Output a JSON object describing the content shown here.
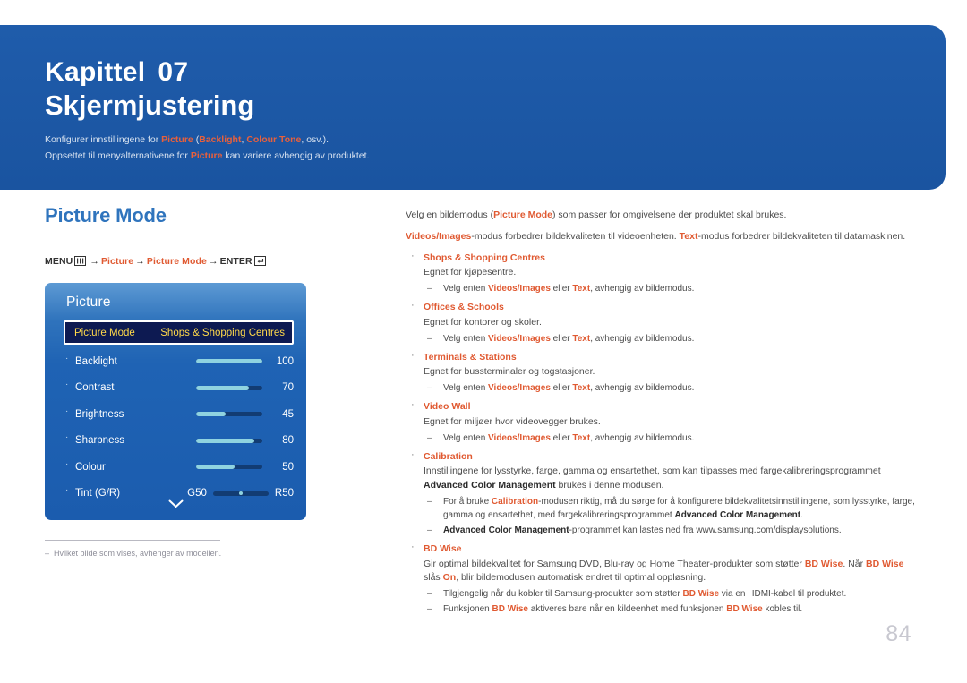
{
  "banner": {
    "chapter_label": "Kapittel",
    "chapter_number": "07",
    "title": "Skjermjustering",
    "sub1_pre": "Konfigurer innstillingene for ",
    "sub1_hl1": "Picture",
    "sub1_mid1": " (",
    "sub1_hl2": "Backlight",
    "sub1_mid2": ", ",
    "sub1_hl3": "Colour Tone",
    "sub1_post": ", osv.).",
    "sub2_pre": "Oppsettet til menyalternativene for ",
    "sub2_hl": "Picture",
    "sub2_post": " kan variere avhengig av produktet."
  },
  "left": {
    "section_title": "Picture Mode",
    "menu_path": {
      "menu_label": "MENU",
      "menu_icon": "menu-bars-icon",
      "arrow": "→",
      "step1": "Picture",
      "step2": "Picture Mode",
      "enter_label": "ENTER",
      "enter_icon": "enter-return-icon"
    },
    "osd": {
      "title": "Picture",
      "selected_row": {
        "label": "Picture Mode",
        "value": "Shops & Shopping Centres"
      },
      "rows": [
        {
          "label": "Backlight",
          "value": "100",
          "percent": 100
        },
        {
          "label": "Contrast",
          "value": "70",
          "percent": 80
        },
        {
          "label": "Brightness",
          "value": "45",
          "percent": 45
        },
        {
          "label": "Sharpness",
          "value": "80",
          "percent": 88
        },
        {
          "label": "Colour",
          "value": "50",
          "percent": 58
        }
      ],
      "tint_row": {
        "label": "Tint (G/R)",
        "left_value": "G50",
        "right_value": "R50"
      },
      "scroll_icon": "chevron-down-icon"
    },
    "footnote": {
      "dash": "–",
      "text": "Hvilket bilde som vises, avhenger av modellen."
    }
  },
  "right": {
    "intro1": {
      "pre": "Velg en bildemodus (",
      "hl": "Picture Mode",
      "post": ") som passer for omgivelsene der produktet skal brukes."
    },
    "intro2": {
      "hl1": "Videos/Images",
      "mid1": "-modus forbedrer bildekvaliteten til videoenheten. ",
      "hl2": "Text",
      "post": "-modus forbedrer bildekvaliteten til datamaskinen."
    },
    "sub_note": {
      "pre": "Velg enten ",
      "hl1": "Videos/Images",
      "mid": " eller ",
      "hl2": "Text",
      "post": ", avhengig av bildemodus."
    },
    "bullets": [
      {
        "title": "Shops & Shopping Centres",
        "body": "Egnet for kjøpesentre."
      },
      {
        "title": "Offices & Schools",
        "body": "Egnet for kontorer og skoler."
      },
      {
        "title": "Terminals & Stations",
        "body": "Egnet for bussterminaler og togstasjoner."
      },
      {
        "title": "Video Wall",
        "body": "Egnet for miljøer hvor videovegger brukes."
      }
    ],
    "calibration": {
      "title": "Calibration",
      "body_pre": "Innstillingene for lysstyrke, farge, gamma og ensartethet, som kan tilpasses med fargekalibreringsprogrammet ",
      "body_bold": "Advanced Color Management",
      "body_post": " brukes i denne modusen.",
      "sub1_pre": "For å bruke ",
      "sub1_hl": "Calibration",
      "sub1_mid": "-modusen riktig, må du sørge for å konfigurere bildekvalitetsinnstillingene, som lysstyrke, farge, gamma og ensartethet, med fargekalibreringsprogrammet ",
      "sub1_bold": "Advanced Color Management",
      "sub1_post": ".",
      "sub2_bold": "Advanced Color Management",
      "sub2_post": "-programmet kan lastes ned fra www.samsung.com/displaysolutions."
    },
    "bdwise": {
      "title": "BD Wise",
      "body_pre": "Gir optimal bildekvalitet for Samsung DVD, Blu-ray og Home Theater-produkter som støtter ",
      "body_hl1": "BD Wise",
      "body_mid1": ". Når ",
      "body_hl2": "BD Wise",
      "body_mid2": " slås ",
      "body_hl3": "On",
      "body_post": ", blir bildemodusen automatisk endret til optimal oppløsning.",
      "sub1_pre": "Tilgjengelig når du kobler til Samsung-produkter som støtter ",
      "sub1_hl": "BD Wise",
      "sub1_post": " via en HDMI-kabel til produktet.",
      "sub2_pre": "Funksjonen ",
      "sub2_hl1": "BD Wise",
      "sub2_mid": " aktiveres bare når en kildeenhet med funksjonen ",
      "sub2_hl2": "BD Wise",
      "sub2_post": " kobles til."
    },
    "bullet_marker": "·",
    "sub_marker": "–"
  },
  "page_number": "84",
  "colors": {
    "banner_blue": "#1b5aa8",
    "accent_orange": "#e05a32",
    "section_blue": "#2f74bd",
    "osd_selected_bg": "#0d1a52",
    "osd_selected_text": "#ffd94a",
    "slider_fill": "#8fd3e0",
    "page_num_gray": "#c8c8d0"
  }
}
